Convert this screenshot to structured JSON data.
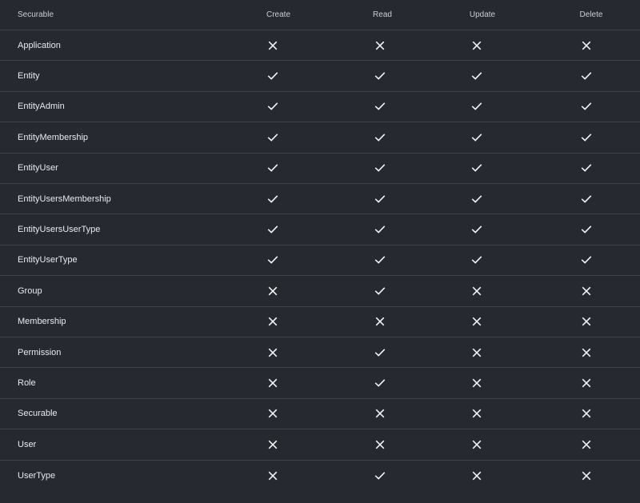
{
  "columns": {
    "securable": "Securable",
    "create": "Create",
    "read": "Read",
    "update": "Update",
    "delete": "Delete"
  },
  "rows": [
    {
      "name": "Application",
      "create": "cross-icon",
      "read": "cross-icon",
      "update": "cross-icon",
      "delete": "cross-icon"
    },
    {
      "name": "Entity",
      "create": "check-icon",
      "read": "check-icon",
      "update": "check-icon",
      "delete": "check-icon"
    },
    {
      "name": "EntityAdmin",
      "create": "check-icon",
      "read": "check-icon",
      "update": "check-icon",
      "delete": "check-icon"
    },
    {
      "name": "EntityMembership",
      "create": "check-icon",
      "read": "check-icon",
      "update": "check-icon",
      "delete": "check-icon"
    },
    {
      "name": "EntityUser",
      "create": "check-icon",
      "read": "check-icon",
      "update": "check-icon",
      "delete": "check-icon"
    },
    {
      "name": "EntityUsersMembership",
      "create": "check-icon",
      "read": "check-icon",
      "update": "check-icon",
      "delete": "check-icon"
    },
    {
      "name": "EntityUsersUserType",
      "create": "check-icon",
      "read": "check-icon",
      "update": "check-icon",
      "delete": "check-icon"
    },
    {
      "name": "EntityUserType",
      "create": "check-icon",
      "read": "check-icon",
      "update": "check-icon",
      "delete": "check-icon"
    },
    {
      "name": "Group",
      "create": "cross-icon",
      "read": "check-icon",
      "update": "cross-icon",
      "delete": "cross-icon"
    },
    {
      "name": "Membership",
      "create": "cross-icon",
      "read": "cross-icon",
      "update": "cross-icon",
      "delete": "cross-icon"
    },
    {
      "name": "Permission",
      "create": "cross-icon",
      "read": "check-icon",
      "update": "cross-icon",
      "delete": "cross-icon"
    },
    {
      "name": "Role",
      "create": "cross-icon",
      "read": "check-icon",
      "update": "cross-icon",
      "delete": "cross-icon"
    },
    {
      "name": "Securable",
      "create": "cross-icon",
      "read": "cross-icon",
      "update": "cross-icon",
      "delete": "cross-icon"
    },
    {
      "name": "User",
      "create": "cross-icon",
      "read": "cross-icon",
      "update": "cross-icon",
      "delete": "cross-icon"
    },
    {
      "name": "UserType",
      "create": "cross-icon",
      "read": "check-icon",
      "update": "cross-icon",
      "delete": "cross-icon"
    }
  ],
  "colors": {
    "background": "#262a30",
    "divider": "#3f444b",
    "text": "#e8eaed"
  }
}
